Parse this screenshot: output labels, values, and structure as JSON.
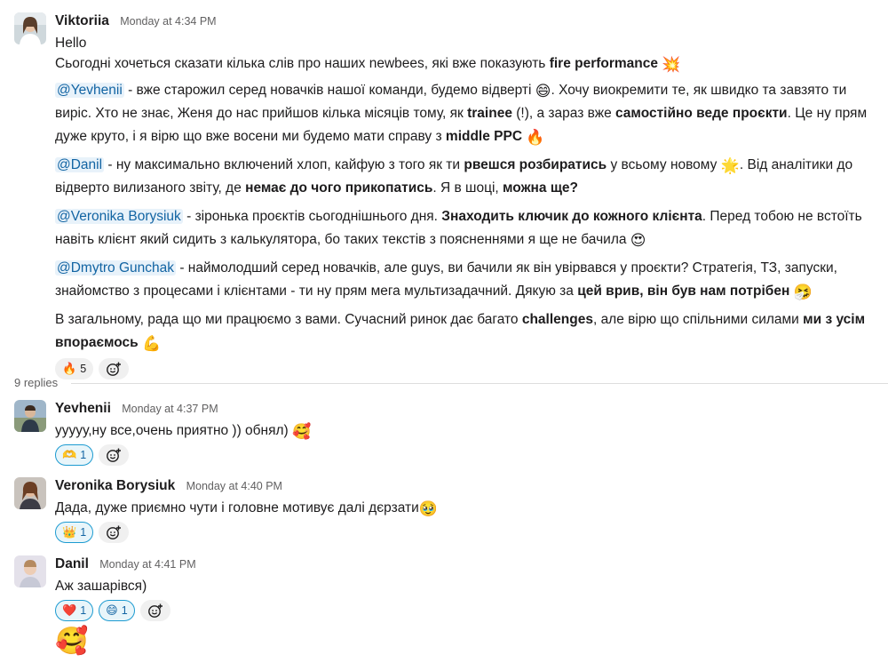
{
  "thread": {
    "parent": {
      "author": "Viktoriia",
      "time": "Monday at 4:34 PM",
      "greeting": "Hello",
      "intro": "Сьогодні хочеться сказати кілька слів про наших newbees, які вже показують ",
      "intro_bold": "fire performance",
      "intro_emoji": "💥",
      "p1_mention": "@Yevhenii",
      "p1_a": " - вже старожил серед новачків нашої команди, будемо відверті ",
      "p1_emoji1": "😄",
      "p1_b": ". Хочу виокремити те, як швидко та завзято ти виріс. Хто не знає, Женя до нас прийшов кілька місяців тому, як ",
      "p1_bold1": "trainee",
      "p1_c": " (!), а зараз вже ",
      "p1_bold2": "самостійно веде проєкти",
      "p1_d": ". Це ну прям дуже круто, і я вірю що вже восени ми будемо мати справу з ",
      "p1_bold3": "middle PPC",
      "p1_emoji2": "🔥",
      "p2_mention": "@Danil",
      "p2_a": " - ну максимально включений хлоп, кайфую з того як ти ",
      "p2_bold1": "рвешся розбиратись",
      "p2_b": " у всьому новому ",
      "p2_emoji": "🌟",
      "p2_c": ". Від аналітики до відверто вилизаного звіту, де ",
      "p2_bold2": "немає до чого прикопатись",
      "p2_d": ". Я в шоці, ",
      "p2_bold3": "можна ще?",
      "p3_mention": "@Veronika Borysiuk",
      "p3_a": " - зіронька проєктів сьогоднішнього дня. ",
      "p3_bold": "Знаходить ключик до кожного клієнта",
      "p3_b": ". Перед тобою не встоїть навіть клієнт який сидить з калькулятора, бо таких текстів з поясненнями я ще не бачила ",
      "p3_emoji": "😍",
      "p4_mention": "@Dmytro Gunchak",
      "p4_a": " - наймолодший серед новачків, але guys, ви бачили як він увірвався у проєкти? Стратегія, ТЗ, запуски, знайомство з процесами і клієнтами - ти ну прям мега мультизадачний. Дякую за ",
      "p4_bold": "цей врив, він був нам потрібен",
      "p4_emoji": "🤧",
      "p5_a": "В загальному, рада що ми працюємо з вами. Сучасний ринок дає багато ",
      "p5_bold1": "challenges",
      "p5_b": ", але вірю що спільними силами ",
      "p5_bold2": "ми з усім впораємось",
      "p5_emoji": "💪",
      "reaction_emoji": "🔥",
      "reaction_count": "5"
    },
    "replies_label": "9 replies",
    "replies": [
      {
        "author": "Yevhenii",
        "time": "Monday at 4:37 PM",
        "text": "ууууу,ну все,очень приятно )) обнял) ",
        "emoji": "🥰",
        "reactions": [
          {
            "emoji": "🫶",
            "count": "1",
            "mine": true
          }
        ]
      },
      {
        "author": "Veronika Borysiuk",
        "time": "Monday at 4:40 PM",
        "text": "Дада, дуже приємно чути і головне мотивує далі дєрзати",
        "emoji": "🥹",
        "reactions": [
          {
            "emoji": "👑",
            "count": "1",
            "mine": true
          }
        ]
      },
      {
        "author": "Danil",
        "time": "Monday at 4:41 PM",
        "text": "Аж зашарівся)",
        "emoji": "",
        "reactions": [
          {
            "emoji": "❤️",
            "count": "1",
            "mine": true
          },
          {
            "emoji": "😄",
            "count": "1",
            "mine": true
          }
        ]
      }
    ],
    "trailing_emoji": "🥰"
  },
  "icons": {
    "add_reaction": "add-reaction-icon",
    "avatars": [
      "avatar-viktoriia",
      "avatar-yevhenii",
      "avatar-veronika",
      "avatar-danil"
    ]
  },
  "colors": {
    "mention_text": "#1264a3",
    "mention_bg": "#e8f2fa",
    "reaction_mine_border": "#1d9bd1",
    "reaction_mine_bg": "#e8f5fa"
  }
}
